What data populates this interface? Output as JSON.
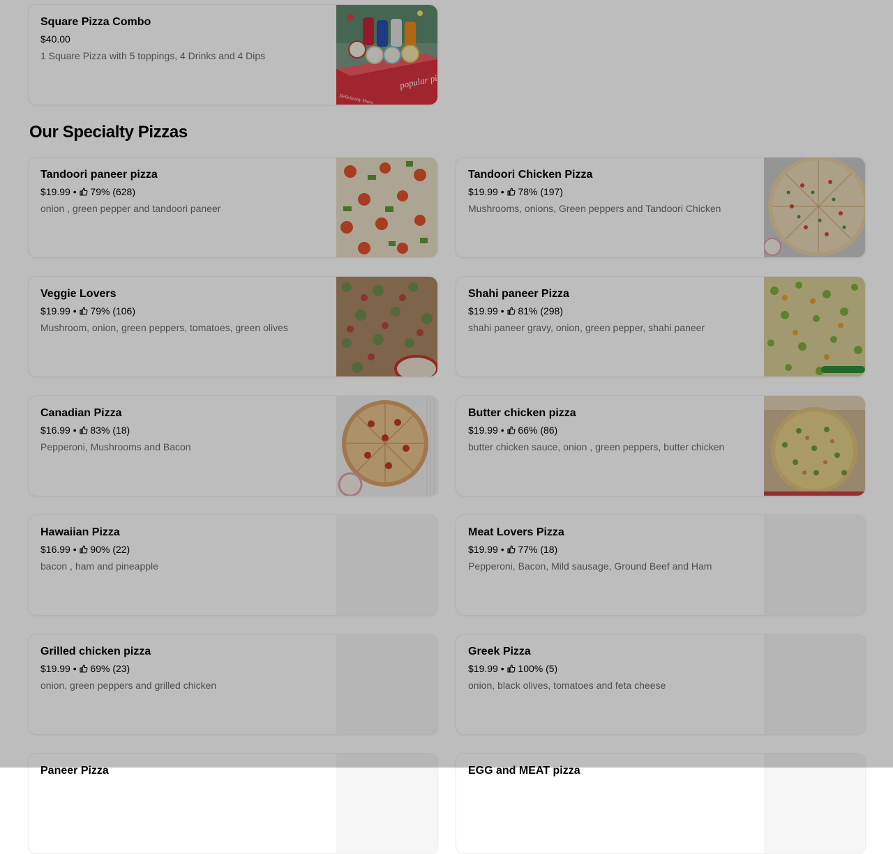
{
  "combo": {
    "name": "Square Pizza Combo",
    "price": "$40.00",
    "desc": "1 Square Pizza with 5 toppings, 4 Drinks and 4 Dips",
    "box_text": "popular pizza",
    "box_text2": "Deliciously Yours"
  },
  "section": {
    "title": "Our Specialty Pizzas"
  },
  "items": [
    {
      "name": "Tandoori paneer pizza",
      "price": "$19.99",
      "rating": "79% (628)",
      "desc": "onion , green pepper and tandoori paneer"
    },
    {
      "name": "Tandoori Chicken Pizza",
      "price": "$19.99",
      "rating": "78% (197)",
      "desc": "Mushrooms, onions, Green peppers and Tandoori Chicken"
    },
    {
      "name": "Veggie Lovers",
      "price": "$19.99",
      "rating": "79% (106)",
      "desc": "Mushroom, onion, green peppers, tomatoes, green olives"
    },
    {
      "name": "Shahi paneer Pizza",
      "price": "$19.99",
      "rating": "81% (298)",
      "desc": "shahi paneer gravy, onion, green pepper, shahi paneer"
    },
    {
      "name": "Canadian Pizza",
      "price": "$16.99",
      "rating": "83% (18)",
      "desc": "Pepperoni, Mushrooms and Bacon"
    },
    {
      "name": "Butter chicken pizza",
      "price": "$19.99",
      "rating": "66% (86)",
      "desc": "butter chicken sauce, onion , green peppers, butter chicken"
    },
    {
      "name": "Hawaiian Pizza",
      "price": "$16.99",
      "rating": "90% (22)",
      "desc": "bacon , ham and pineapple"
    },
    {
      "name": "Meat Lovers Pizza",
      "price": "$19.99",
      "rating": "77% (18)",
      "desc": "Pepperoni, Bacon, Mild sausage, Ground Beef and Ham"
    },
    {
      "name": "Grilled chicken pizza",
      "price": "$19.99",
      "rating": "69% (23)",
      "desc": "onion, green peppers and grilled chicken"
    },
    {
      "name": "Greek Pizza",
      "price": "$19.99",
      "rating": "100% (5)",
      "desc": "onion, black olives, tomatoes and feta cheese"
    },
    {
      "name": "Paneer Pizza",
      "price": "",
      "rating": "",
      "desc": ""
    },
    {
      "name": "EGG and MEAT pizza",
      "price": "",
      "rating": "",
      "desc": ""
    }
  ],
  "separator": " • ",
  "icons": {
    "rating": "thumbs-up-icon"
  },
  "colors": {
    "overlay": "#000000",
    "muted_text": "#6b6b6b"
  }
}
